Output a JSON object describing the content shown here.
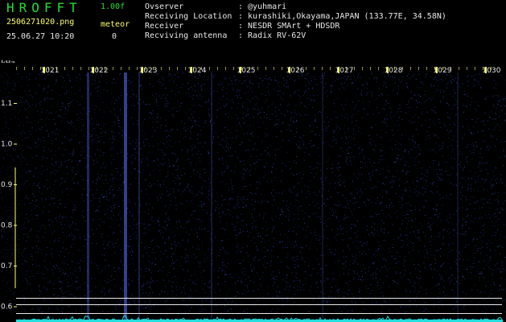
{
  "header": {
    "app_title": "HROFFT",
    "version": "1.00f",
    "filename": "2506271020.png",
    "datetime": "25.06.27 10:20",
    "meteor_label": "meteor",
    "meteor_count": "0"
  },
  "info": [
    {
      "label": "Ovserver",
      "value": ": @yuhmari"
    },
    {
      "label": "Receiving Location",
      "value": ": kurashiki,Okayama,JAPAN (133.77E, 34.58N)"
    },
    {
      "label": "Receiver",
      "value": ": NESDR SMArt + HDSDR"
    },
    {
      "label": "Recviving antenna",
      "value": ": Radix RV-62V"
    }
  ],
  "chart_data": {
    "type": "heatmap",
    "x_unit": "",
    "x_ticks": [
      "1021",
      "1022",
      "1023",
      "1024",
      "1025",
      "1026",
      "1027",
      "1028",
      "1029",
      "1030"
    ],
    "y_unit": "kHz",
    "y_ticks": [
      "1.1",
      "1.0",
      "0.9",
      "0.8",
      "0.7",
      "0.6"
    ],
    "ylim": [
      0.58,
      1.18
    ],
    "colors": {
      "background": "#000000",
      "signal": "#3355ff",
      "trace": "#22dddd",
      "ticks": "#ffff66",
      "lines": "#e8e8e8"
    }
  }
}
